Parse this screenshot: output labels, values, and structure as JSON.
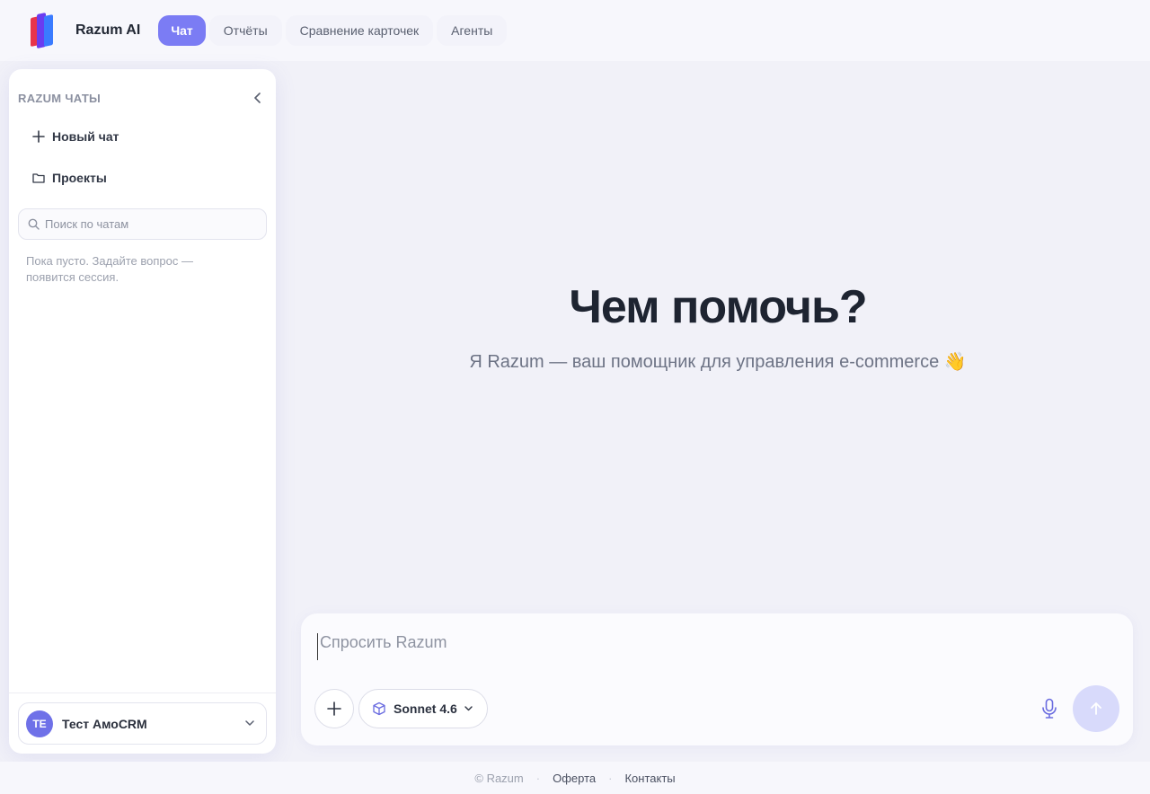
{
  "header": {
    "brand": "Razum AI",
    "tabs": [
      {
        "label": "Чат",
        "active": true
      },
      {
        "label": "Отчёты",
        "active": false
      },
      {
        "label": "Сравнение карточек",
        "active": false
      },
      {
        "label": "Агенты",
        "active": false
      }
    ]
  },
  "sidebar": {
    "title": "RAZUM ЧАТЫ",
    "new_chat": "Новый чат",
    "projects": "Проекты",
    "search_placeholder": "Поиск по чатам",
    "empty_text": "Пока пусто. Задайте вопрос — появится сессия.",
    "account": {
      "initials": "TE",
      "name": "Тест АмоCRM"
    }
  },
  "main": {
    "title": "Чем помочь?",
    "subtitle": "Я Razum — ваш помощник для управления e-commerce 👋"
  },
  "composer": {
    "placeholder": "Спросить Razum",
    "model": "Sonnet 4.6"
  },
  "footer": {
    "copyright": "© Razum",
    "offer": "Оферта",
    "contacts": "Контакты"
  },
  "colors": {
    "accent": "#7b7cf4",
    "avatar": "#6f71e8",
    "send_button": "#d8dafb"
  },
  "icons": [
    "plus-icon",
    "folder-icon",
    "search-icon",
    "chevron-left-icon",
    "chevron-down-icon",
    "cube-icon",
    "microphone-icon",
    "arrow-up-icon"
  ]
}
